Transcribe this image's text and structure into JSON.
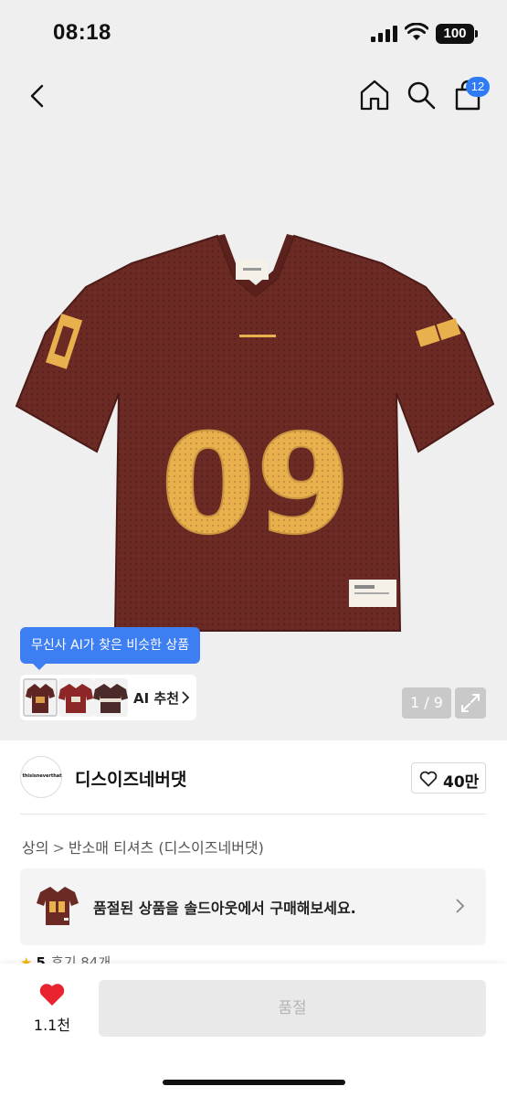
{
  "status_bar": {
    "time": "08:18",
    "battery": "100"
  },
  "header": {
    "cart_count": "12"
  },
  "gallery": {
    "jersey_number": "09",
    "page_indicator": "1 / 9"
  },
  "ai_recommend": {
    "tooltip": "무신사 AI가 찾은 비슷한 상품",
    "label": "AI 추천"
  },
  "brand": {
    "name": "디스이즈네버댓",
    "logo_text": "thisisneverthat",
    "like_count": "40만"
  },
  "breadcrumb": {
    "items": [
      "상의",
      "반소매 티셔츠 (디스이즈네버댓)"
    ],
    "separator": ">"
  },
  "soldout_banner": {
    "text": "품절된 상품을 솔드아웃에서 구매해보세요."
  },
  "rating": {
    "score": "5",
    "reviews": "후기 84개"
  },
  "bottom_bar": {
    "wish_count": "1.1천",
    "buy_label": "품절"
  },
  "colors": {
    "jersey": "#6b2a24",
    "number": "#e9b04e",
    "accent": "#3d7ff2",
    "heart": "#e8232f"
  }
}
